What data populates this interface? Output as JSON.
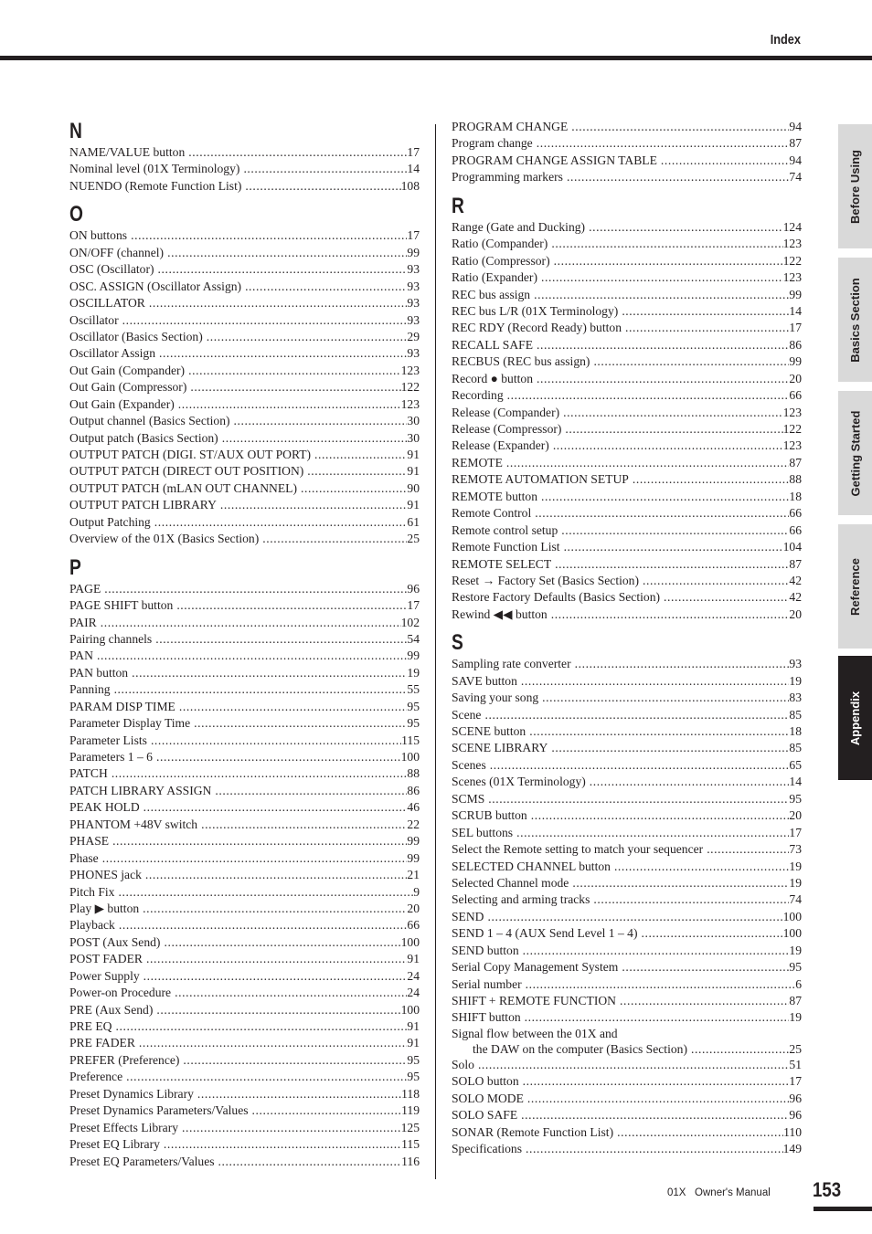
{
  "header": {
    "title": "Index"
  },
  "columns": [
    {
      "sections": [
        {
          "letter": "N",
          "entries": [
            {
              "term": "NAME/VALUE button",
              "page": "17"
            },
            {
              "term": "Nominal level (01X Terminology)",
              "page": "14"
            },
            {
              "term": "NUENDO (Remote Function List)",
              "page": "108"
            }
          ]
        },
        {
          "letter": "O",
          "entries": [
            {
              "term": "ON buttons",
              "page": "17"
            },
            {
              "term": "ON/OFF (channel)",
              "page": "99"
            },
            {
              "term": "OSC (Oscillator)",
              "page": "93"
            },
            {
              "term": "OSC. ASSIGN (Oscillator Assign)",
              "page": "93"
            },
            {
              "term": "OSCILLATOR",
              "page": "93"
            },
            {
              "term": "Oscillator",
              "page": "93"
            },
            {
              "term": "Oscillator (Basics Section)",
              "page": "29"
            },
            {
              "term": "Oscillator Assign",
              "page": "93"
            },
            {
              "term": "Out Gain (Compander)",
              "page": "123"
            },
            {
              "term": "Out Gain (Compressor)",
              "page": "122"
            },
            {
              "term": "Out Gain (Expander)",
              "page": "123"
            },
            {
              "term": "Output channel (Basics Section)",
              "page": "30"
            },
            {
              "term": "Output patch (Basics Section)",
              "page": "30"
            },
            {
              "term": "OUTPUT PATCH (DIGI. ST/AUX OUT PORT)",
              "page": "91"
            },
            {
              "term": "OUTPUT PATCH (DIRECT OUT POSITION)",
              "page": "91"
            },
            {
              "term": "OUTPUT PATCH (mLAN OUT CHANNEL)",
              "page": "90"
            },
            {
              "term": "OUTPUT PATCH LIBRARY",
              "page": "91"
            },
            {
              "term": "Output Patching",
              "page": "61"
            },
            {
              "term": "Overview of the 01X (Basics Section)",
              "page": "25"
            }
          ]
        },
        {
          "letter": "P",
          "entries": [
            {
              "term": "PAGE",
              "page": "96"
            },
            {
              "term": "PAGE SHIFT button",
              "page": "17"
            },
            {
              "term": "PAIR",
              "page": "102"
            },
            {
              "term": "Pairing channels",
              "page": "54"
            },
            {
              "term": "PAN",
              "page": "99"
            },
            {
              "term": "PAN button",
              "page": "19"
            },
            {
              "term": "Panning",
              "page": "55"
            },
            {
              "term": "PARAM DISP TIME",
              "page": "95"
            },
            {
              "term": "Parameter Display Time",
              "page": "95"
            },
            {
              "term": "Parameter Lists",
              "page": "115"
            },
            {
              "term": "Parameters 1 – 6",
              "page": "100"
            },
            {
              "term": "PATCH",
              "page": "88"
            },
            {
              "term": "PATCH LIBRARY ASSIGN",
              "page": "86"
            },
            {
              "term": "PEAK HOLD",
              "page": "46"
            },
            {
              "term": "PHANTOM +48V switch",
              "page": "22"
            },
            {
              "term": "PHASE",
              "page": "99"
            },
            {
              "term": "Phase",
              "page": "99"
            },
            {
              "term": "PHONES jack",
              "page": "21"
            },
            {
              "term": "Pitch Fix",
              "page": "9"
            },
            {
              "term": "Play ▶ button",
              "page": "20"
            },
            {
              "term": "Playback",
              "page": "66"
            },
            {
              "term": "POST (Aux Send)",
              "page": "100"
            },
            {
              "term": "POST FADER",
              "page": "91"
            },
            {
              "term": "Power Supply",
              "page": "24"
            },
            {
              "term": "Power-on Procedure",
              "page": "24"
            },
            {
              "term": "PRE (Aux Send)",
              "page": "100"
            },
            {
              "term": "PRE EQ",
              "page": "91"
            },
            {
              "term": "PRE FADER",
              "page": "91"
            },
            {
              "term": "PREFER (Preference)",
              "page": "95"
            },
            {
              "term": "Preference",
              "page": "95"
            },
            {
              "term": "Preset Dynamics Library",
              "page": "118"
            },
            {
              "term": "Preset Dynamics Parameters/Values",
              "page": "119"
            },
            {
              "term": "Preset Effects Library",
              "page": "125"
            },
            {
              "term": "Preset EQ Library",
              "page": "115"
            },
            {
              "term": "Preset EQ Parameters/Values",
              "page": "116"
            }
          ]
        }
      ]
    },
    {
      "sections": [
        {
          "letter": "",
          "entries": [
            {
              "term": "PROGRAM CHANGE",
              "page": "94"
            },
            {
              "term": "Program change",
              "page": "87"
            },
            {
              "term": "PROGRAM CHANGE ASSIGN TABLE",
              "page": "94"
            },
            {
              "term": "Programming markers",
              "page": "74"
            }
          ]
        },
        {
          "letter": "R",
          "entries": [
            {
              "term": "Range (Gate and Ducking)",
              "page": "124"
            },
            {
              "term": "Ratio (Compander)",
              "page": "123"
            },
            {
              "term": "Ratio (Compressor)",
              "page": "122"
            },
            {
              "term": "Ratio (Expander)",
              "page": "123"
            },
            {
              "term": "REC bus assign",
              "page": "99"
            },
            {
              "term": "REC bus L/R (01X Terminology)",
              "page": "14"
            },
            {
              "term": "REC RDY (Record Ready) button",
              "page": "17"
            },
            {
              "term": "RECALL SAFE",
              "page": "86"
            },
            {
              "term": "RECBUS (REC bus assign)",
              "page": "99"
            },
            {
              "term": "Record ● button",
              "page": "20"
            },
            {
              "term": "Recording",
              "page": "66"
            },
            {
              "term": "Release (Compander)",
              "page": "123"
            },
            {
              "term": "Release (Compressor)",
              "page": "122"
            },
            {
              "term": "Release (Expander)",
              "page": "123"
            },
            {
              "term": "REMOTE",
              "page": "87"
            },
            {
              "term": "REMOTE AUTOMATION SETUP",
              "page": "88"
            },
            {
              "term": "REMOTE button",
              "page": "18"
            },
            {
              "term": "Remote Control",
              "page": "66"
            },
            {
              "term": "Remote control setup",
              "page": "66"
            },
            {
              "term": "Remote Function List",
              "page": "104"
            },
            {
              "term": "REMOTE SELECT",
              "page": "87"
            },
            {
              "term": "Reset → Factory Set (Basics Section)",
              "page": "42"
            },
            {
              "term": "Restore Factory Defaults (Basics Section)",
              "page": "42"
            },
            {
              "term": "Rewind ◀◀ button",
              "page": "20"
            }
          ]
        },
        {
          "letter": "S",
          "entries": [
            {
              "term": "Sampling rate converter",
              "page": "93"
            },
            {
              "term": "SAVE button",
              "page": "19"
            },
            {
              "term": "Saving your song",
              "page": "83"
            },
            {
              "term": "Scene",
              "page": "85"
            },
            {
              "term": "SCENE button",
              "page": "18"
            },
            {
              "term": "SCENE LIBRARY",
              "page": "85"
            },
            {
              "term": "Scenes",
              "page": "65"
            },
            {
              "term": "Scenes (01X Terminology)",
              "page": "14"
            },
            {
              "term": "SCMS",
              "page": "95"
            },
            {
              "term": "SCRUB button",
              "page": "20"
            },
            {
              "term": "SEL buttons",
              "page": "17"
            },
            {
              "term": "Select the Remote setting to match your sequencer",
              "page": "73"
            },
            {
              "term": "SELECTED CHANNEL button",
              "page": "19"
            },
            {
              "term": "Selected Channel mode",
              "page": "19"
            },
            {
              "term": "Selecting and arming tracks",
              "page": "74"
            },
            {
              "term": "SEND",
              "page": "100"
            },
            {
              "term": "SEND 1 – 4 (AUX Send Level 1 – 4)",
              "page": "100"
            },
            {
              "term": "SEND button",
              "page": "19"
            },
            {
              "term": "Serial Copy Management System",
              "page": "95"
            },
            {
              "term": "Serial number",
              "page": "6"
            },
            {
              "term": "SHIFT + REMOTE FUNCTION",
              "page": "87"
            },
            {
              "term": "SHIFT button",
              "page": "19"
            },
            {
              "term": "Signal flow between the 01X and",
              "continuation": "the DAW on the computer (Basics Section)",
              "page": "25"
            },
            {
              "term": "Solo",
              "page": "51"
            },
            {
              "term": "SOLO button",
              "page": "17"
            },
            {
              "term": "SOLO MODE",
              "page": "96"
            },
            {
              "term": "SOLO SAFE",
              "page": "96"
            },
            {
              "term": "SONAR (Remote Function List)",
              "page": "110"
            },
            {
              "term": "Specifications",
              "page": "149"
            }
          ]
        }
      ]
    }
  ],
  "side_tabs": [
    {
      "label": "Before Using",
      "active": false
    },
    {
      "label": "Basics Section",
      "active": false
    },
    {
      "label": "Getting Started",
      "active": false
    },
    {
      "label": "Reference",
      "active": false
    },
    {
      "label": "Appendix",
      "active": true
    }
  ],
  "footer": {
    "manual_title": "01X   Owner's Manual",
    "page_number": "153"
  }
}
